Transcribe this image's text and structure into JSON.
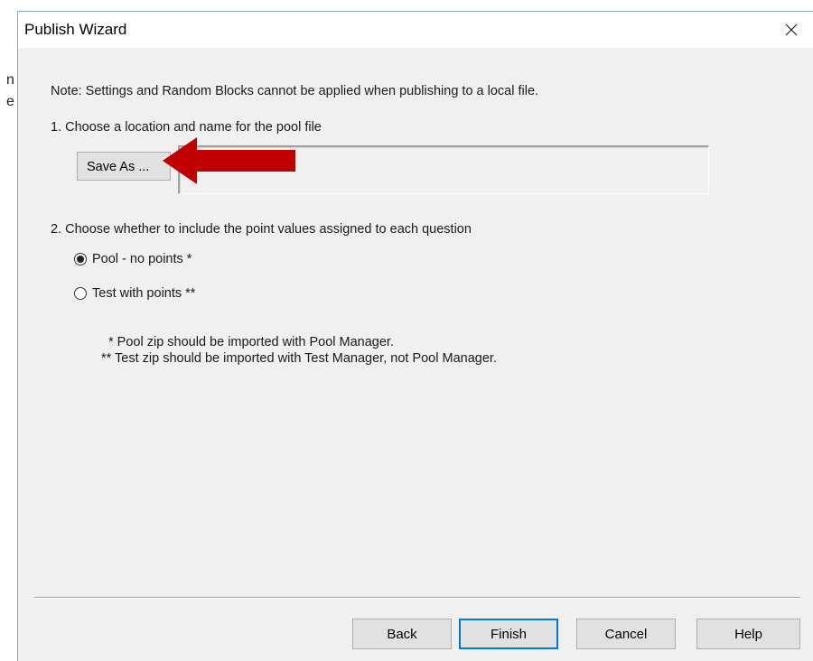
{
  "background": {
    "fragments": [
      "n",
      "e"
    ]
  },
  "window": {
    "title": "Publish Wizard",
    "close_icon": "close-icon"
  },
  "content": {
    "note": "Note: Settings and Random Blocks cannot be applied when publishing to a local file.",
    "step1_label": "1. Choose a location and name for the pool file",
    "save_as_label": "Save As ...",
    "file_path_value": "",
    "step2_label": "2. Choose whether to include the point values assigned to each question",
    "options": [
      {
        "label": "Pool - no points *",
        "selected": true
      },
      {
        "label": "Test with points **",
        "selected": false
      }
    ],
    "footnotes": [
      "* Pool zip should be imported with Pool Manager.",
      "** Test zip should be imported with Test Manager, not Pool Manager."
    ]
  },
  "annotation": {
    "arrow_color": "#c00000"
  },
  "buttons": {
    "back": "Back",
    "finish": "Finish",
    "cancel": "Cancel",
    "help": "Help"
  },
  "colors": {
    "default_button_border": "#0078d7"
  }
}
